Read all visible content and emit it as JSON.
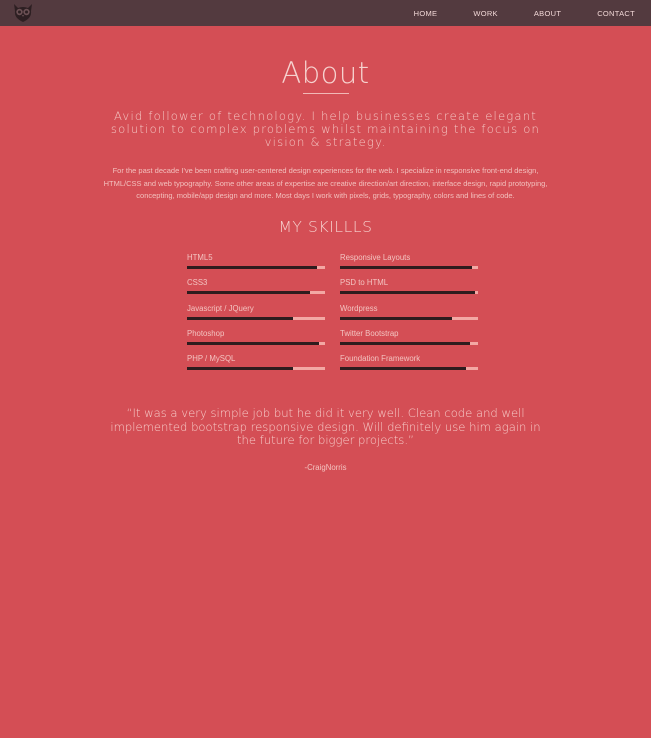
{
  "header": {
    "logo_icon": "owl-icon",
    "nav": [
      {
        "label": "HOME"
      },
      {
        "label": "WORK"
      },
      {
        "label": "ABOUT"
      },
      {
        "label": "CONTACT"
      }
    ]
  },
  "about": {
    "title": "About",
    "tagline": "Avid follower of technology. I help businesses create elegant solution to complex problems whilst maintaining the focus on vision & strategy.",
    "intro": "For the past decade I've been crafting user-centered design experiences for the web. I specialize in responsive front-end design, HTML/CSS and web typography. Some other areas of expertise are creative direction/art direction, interface design, rapid prototyping, concepting, mobile/app design and more. Most days I work with pixels, grids, typography, colors and lines of code."
  },
  "skills": {
    "title": "MY SKILLLS",
    "items": [
      {
        "label": "HTML5",
        "level": 0.94
      },
      {
        "label": "Responsive Layouts",
        "level": 0.96
      },
      {
        "label": "CSS3",
        "level": 0.89
      },
      {
        "label": "PSD to HTML",
        "level": 0.98
      },
      {
        "label": "Javascript / JQuery",
        "level": 0.77
      },
      {
        "label": "Wordpress",
        "level": 0.81
      },
      {
        "label": "Photoshop",
        "level": 0.96
      },
      {
        "label": "Twitter Bootstrap",
        "level": 0.94
      },
      {
        "label": "PHP / MySQL",
        "level": 0.77
      },
      {
        "label": "Foundation Framework",
        "level": 0.91
      }
    ]
  },
  "testimonial": {
    "quote": "“It was a very simple job but he did it very well. Clean code and well implemented bootstrap responsive design. Will definitely use him again in the future for bigger projects.”",
    "author": "-CraigNorris"
  },
  "colors": {
    "background": "#d44e55",
    "topbar": "#533a3f",
    "bar_fill": "#2e1c1e",
    "bar_track": "#f3a8a4"
  }
}
